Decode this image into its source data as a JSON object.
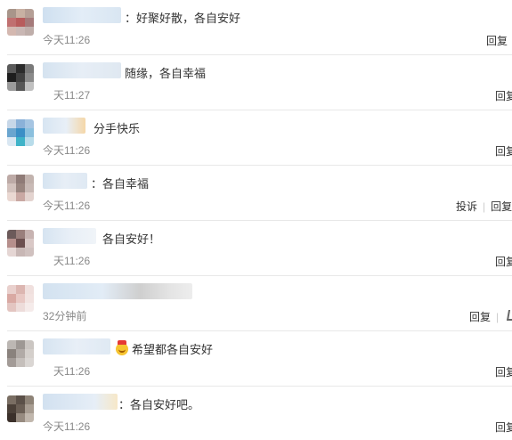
{
  "comments": [
    {
      "text": "：好聚好散，各自安好",
      "time": "今天11:26",
      "actions": [
        "回复"
      ]
    },
    {
      "text": "随缘，各自幸福",
      "time": "天11:27",
      "actions": [
        "回复"
      ]
    },
    {
      "text": "分手快乐",
      "time": "今天11:26",
      "actions": [
        "回复"
      ]
    },
    {
      "text": "：各自幸福",
      "time": "今天11:26",
      "actions": [
        "投诉",
        "回复"
      ]
    },
    {
      "text": "各自安好！",
      "time": "天11:26",
      "actions": [
        "回复"
      ]
    },
    {
      "text": "",
      "time": "32分钟前",
      "actions": [
        "回复"
      ],
      "has_like_icon": true
    },
    {
      "text": "希望都各自安好",
      "time": "天11:26",
      "actions": [
        "回复"
      ],
      "emoji_icon": "crown-smile-emoji"
    },
    {
      "text": "：各自安好吧。",
      "time": "今天11:26",
      "actions": [
        "回复"
      ]
    }
  ],
  "theme": {
    "text_color": "#333333",
    "time_color": "#888888",
    "separator_color": "#e8e8e8"
  }
}
